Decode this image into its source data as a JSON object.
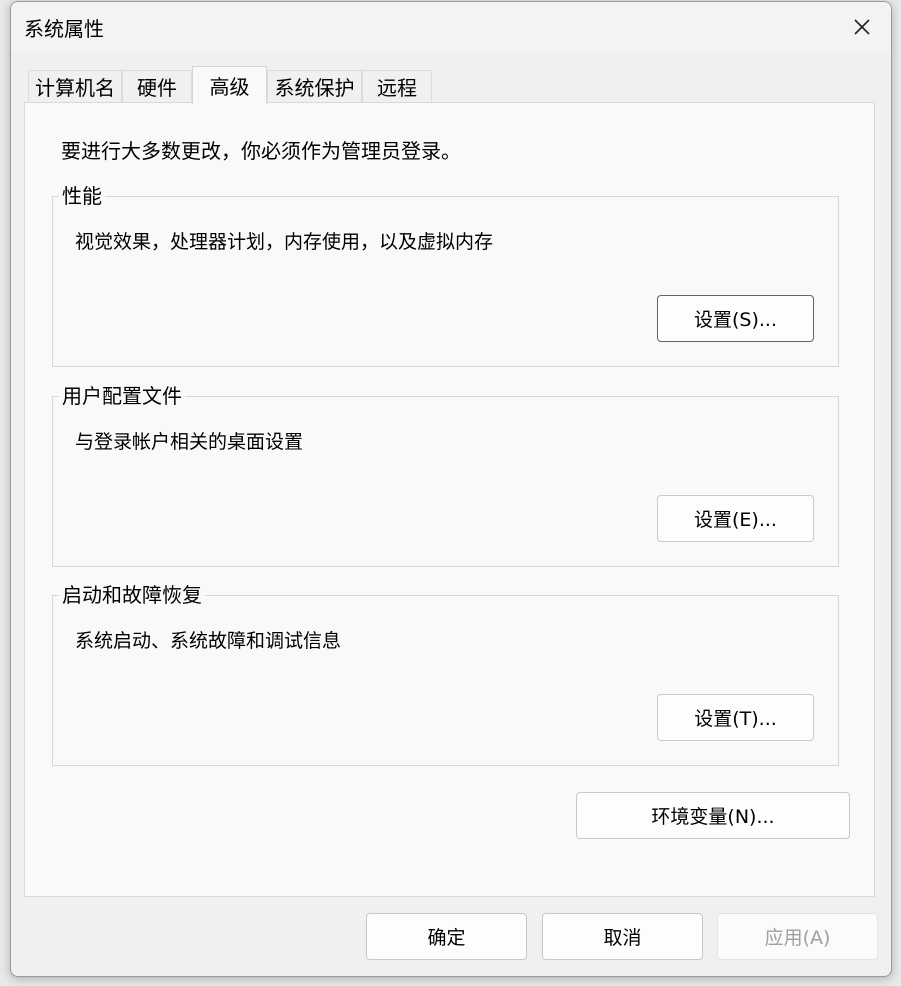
{
  "window": {
    "title": "系统属性"
  },
  "tabs": [
    {
      "label": "计算机名",
      "active": false
    },
    {
      "label": "硬件",
      "active": false
    },
    {
      "label": "高级",
      "active": true
    },
    {
      "label": "系统保护",
      "active": false
    },
    {
      "label": "远程",
      "active": false
    }
  ],
  "advanced": {
    "admin_note": "要进行大多数更改，你必须作为管理员登录。",
    "groups": [
      {
        "title": "性能",
        "description": "视觉效果，处理器计划，内存使用，以及虚拟内存",
        "button": "设置(S)..."
      },
      {
        "title": "用户配置文件",
        "description": "与登录帐户相关的桌面设置",
        "button": "设置(E)..."
      },
      {
        "title": "启动和故障恢复",
        "description": "系统启动、系统故障和调试信息",
        "button": "设置(T)..."
      }
    ],
    "env_button": "环境变量(N)..."
  },
  "footer": {
    "ok": "确定",
    "cancel": "取消",
    "apply": "应用(A)"
  },
  "icons": {
    "close": "close-icon"
  },
  "colors": {
    "default_button_border": "#2f6fb8",
    "disabled_text": "#a0a0a0"
  }
}
